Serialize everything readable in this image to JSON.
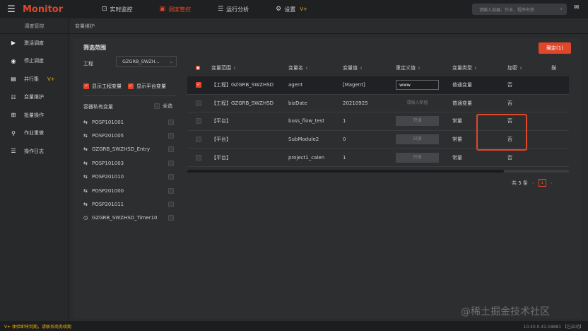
{
  "header": {
    "brand": "Monitor",
    "nav": [
      {
        "label": "实时监控",
        "icon": "monitor-icon"
      },
      {
        "label": "调度管控",
        "icon": "schedule-icon"
      },
      {
        "label": "运行分析",
        "icon": "analysis-icon"
      },
      {
        "label": "设置",
        "icon": "gear-icon",
        "badge": "V+"
      }
    ],
    "search_placeholder": "请输入容器、作业、程序名称"
  },
  "sidebar": {
    "title": "调度管控",
    "items": [
      {
        "label": "激活调度",
        "icon": "play-icon"
      },
      {
        "label": "停止调度",
        "icon": "stop-icon"
      },
      {
        "label": "并行集",
        "icon": "parallel-icon",
        "badge": "V+"
      },
      {
        "label": "变量维护",
        "icon": "variable-icon"
      },
      {
        "label": "批量操作",
        "icon": "batch-icon"
      },
      {
        "label": "作业重做",
        "icon": "redo-icon"
      },
      {
        "label": "操作日志",
        "icon": "log-icon"
      }
    ]
  },
  "breadcrumb": "变量维护",
  "filter": {
    "title": "筛选范围",
    "project_label": "工程",
    "project_value": "GZGRB_SWZH...",
    "show_project_vars": "显示工程变量",
    "show_platform_vars": "显示平台变量",
    "private_title": "容器私有变量",
    "select_all": "全选",
    "containers": [
      {
        "name": "POSP101001",
        "icon": "container-icon"
      },
      {
        "name": "POSP201005",
        "icon": "container-icon"
      },
      {
        "name": "GZGRB_SWZHSD_Entry",
        "icon": "container-icon"
      },
      {
        "name": "POSP101003",
        "icon": "container-icon"
      },
      {
        "name": "POSP201010",
        "icon": "container-icon"
      },
      {
        "name": "POSP201000",
        "icon": "container-icon"
      },
      {
        "name": "POSP201011",
        "icon": "container-icon"
      },
      {
        "name": "GZGRB_SWZHSD_Timer10",
        "icon": "clock-icon"
      }
    ]
  },
  "confirm_label": "确定(1)",
  "table": {
    "headers": [
      "变量范围",
      "变量名",
      "变量值",
      "重定义值",
      "变量类型",
      "加密",
      "描"
    ],
    "rows": [
      {
        "scope": "【工程】GZGRB_SWZHSD",
        "name": "agent",
        "value": "[Magent]",
        "redef": "www",
        "redef_mode": "input",
        "type": "普通变量",
        "encrypt": "否",
        "checked": true
      },
      {
        "scope": "【工程】GZGRB_SWZHSD",
        "name": "bizDate",
        "value": "20210925",
        "redef": "请输入新值",
        "redef_mode": "placeholder",
        "type": "普通变量",
        "encrypt": "否",
        "checked": false
      },
      {
        "scope": "【平台】",
        "name": "buss_flow_test",
        "value": "1",
        "redef": "只读",
        "redef_mode": "disabled",
        "type": "常量",
        "encrypt": "否",
        "checked": false
      },
      {
        "scope": "【平台】",
        "name": "SubModule2",
        "value": "0",
        "redef": "只读",
        "redef_mode": "disabled",
        "type": "常量",
        "encrypt": "否",
        "checked": false
      },
      {
        "scope": "【平台】",
        "name": "project1_calen",
        "value": "1",
        "redef": "只读",
        "redef_mode": "disabled",
        "type": "常量",
        "encrypt": "否",
        "checked": false
      }
    ]
  },
  "pagination": {
    "total": "共 5 条",
    "current": "1"
  },
  "watermark": "@稀土掘金技术社区",
  "footer": {
    "warning": "V+ 体验即将到期，请联系商务续期",
    "status": "10.40.0.41:18881 【已启动】"
  },
  "colors": {
    "accent": "#e0462a",
    "warn": "#f0b000"
  }
}
